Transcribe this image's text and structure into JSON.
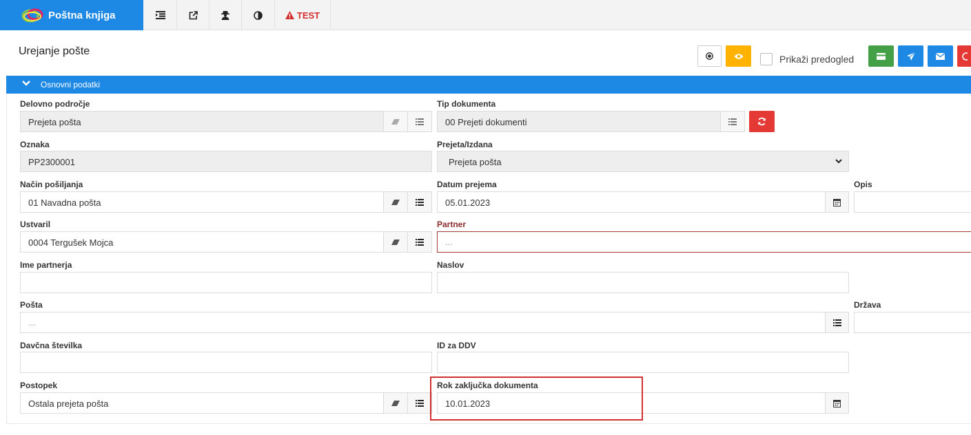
{
  "app": {
    "title": "Poštna knjiga"
  },
  "toolbar": {
    "test_label": "TEST"
  },
  "page": {
    "title": "Urejanje pošte"
  },
  "header": {
    "preview_label": "Prikaži predogled"
  },
  "section": {
    "title": "Osnovni podatki"
  },
  "form": {
    "delovno_podrocje": {
      "label": "Delovno področje",
      "value": "Prejeta pošta"
    },
    "tip_dokumenta": {
      "label": "Tip dokumenta",
      "value": "00 Prejeti dokumenti"
    },
    "oznaka": {
      "label": "Oznaka",
      "value": "PP2300001"
    },
    "prejeta_izdana": {
      "label": "Prejeta/Izdana",
      "value": "Prejeta pošta"
    },
    "nacin_posiljanja": {
      "label": "Način pošiljanja",
      "value": "01 Navadna pošta"
    },
    "datum_prejema": {
      "label": "Datum prejema",
      "value": "05.01.2023"
    },
    "opis": {
      "label": "Opis",
      "value": ""
    },
    "ustvaril": {
      "label": "Ustvaril",
      "value": "0004 Tergušek Mojca"
    },
    "partner": {
      "label": "Partner",
      "placeholder": "..."
    },
    "ime_partnerja": {
      "label": "Ime partnerja",
      "value": ""
    },
    "naslov": {
      "label": "Naslov",
      "value": ""
    },
    "posta": {
      "label": "Pošta",
      "placeholder": "..."
    },
    "drzava": {
      "label": "Država",
      "value": ""
    },
    "davcna_stevilka": {
      "label": "Davčna številka",
      "value": ""
    },
    "id_za_ddv": {
      "label": "ID za DDV",
      "value": ""
    },
    "postopek": {
      "label": "Postopek",
      "value": "Ostala prejeta pošta"
    },
    "rok_zakljucka": {
      "label": "Rok zaključka dokumenta",
      "value": "10.01.2023"
    }
  },
  "colors": {
    "brand": "#1e88e5",
    "success": "#43a047",
    "warning": "#ffb300",
    "danger": "#e53935",
    "highlight": "#d32f2f"
  },
  "icons": [
    "list-indent-icon",
    "external-link-icon",
    "user-secret-icon",
    "contrast-icon",
    "warning-icon",
    "stop-circle-icon",
    "eye-icon",
    "credit-card-icon",
    "send-icon",
    "envelope-icon",
    "eraser-icon",
    "list-icon",
    "refresh-icon",
    "calendar-icon",
    "chevron-down-icon"
  ]
}
